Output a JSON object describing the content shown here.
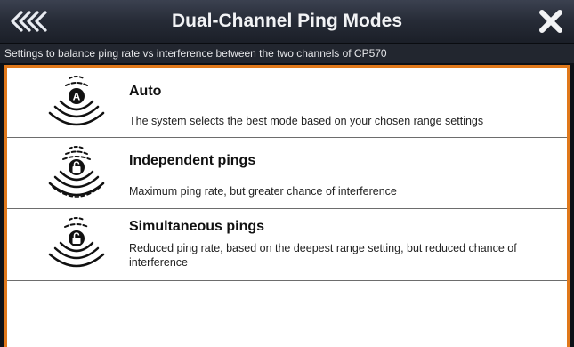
{
  "header": {
    "title": "Dual-Channel Ping Modes",
    "back_icon": "back-chevrons-icon",
    "close_icon": "close-x-icon"
  },
  "subtitle": "Settings to balance ping rate vs interference between the two channels of CP570",
  "modes": [
    {
      "title": "Auto",
      "description": "The system selects the best mode based on your chosen range settings",
      "icon": "sonar-auto-icon",
      "icon_letter": "A"
    },
    {
      "title": "Independent pings",
      "description": "Maximum ping rate, but greater chance of interference",
      "icon": "sonar-independent-icon"
    },
    {
      "title": "Simultaneous pings",
      "description": "Reduced ping rate, based on the deepest range setting, but reduced chance of interference",
      "icon": "sonar-simultaneous-icon"
    }
  ],
  "colors": {
    "accent": "#e0781a",
    "title_bar": "#262b36",
    "list_background": "#ffffff"
  }
}
